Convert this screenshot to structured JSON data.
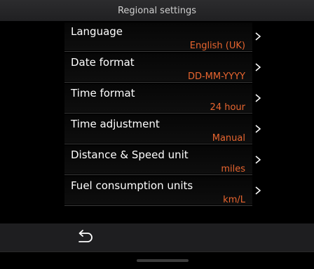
{
  "header": {
    "title": "Regional settings"
  },
  "settings": [
    {
      "label": "Language",
      "value": "English (UK)"
    },
    {
      "label": "Date format",
      "value": "DD-MM-YYYY"
    },
    {
      "label": "Time format",
      "value": "24 hour"
    },
    {
      "label": "Time adjustment",
      "value": "Manual"
    },
    {
      "label": "Distance & Speed unit",
      "value": "miles"
    },
    {
      "label": "Fuel consumption units",
      "value": "km/L"
    }
  ],
  "colors": {
    "accent": "#e8652f",
    "background": "#000000",
    "title_bar": "#2c2c2e",
    "bottom_bar": "#1e1e20"
  },
  "icons": {
    "row_action": "chevron-right-icon",
    "back": "back-arrow-icon"
  }
}
